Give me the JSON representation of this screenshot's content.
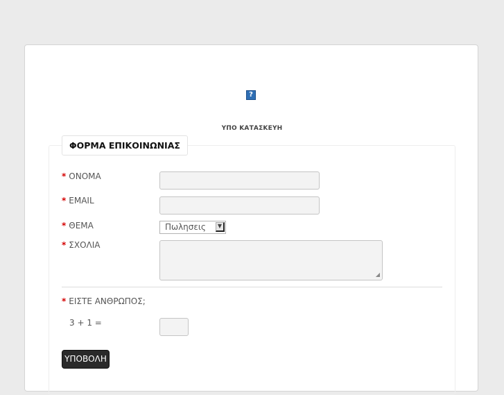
{
  "header": {
    "icon": "broken-image-question-icon",
    "icon_glyph": "?",
    "notice": "ΥΠΟ ΚΑΤΑΣΚΕΥΗ"
  },
  "form": {
    "legend": "ΦΟΡΜΑ ΕΠΙΚΟΙΝΩΝΙΑΣ",
    "required_mark": "*",
    "fields": {
      "name_label": "ΟΝΟΜΑ",
      "name_value": "",
      "email_label": "EMAIL",
      "email_value": "",
      "subject_label": "ΘΕΜΑ",
      "subject_selected": "Πωλησεις",
      "subject_arrow": "▼",
      "comments_label": "ΣΧΟΛΙΑ",
      "comments_value": ""
    },
    "captcha": {
      "label": "ΕΙΣΤΕ ΑΝΘΡΩΠΟΣ;",
      "question": "3 + 1 =",
      "answer": ""
    },
    "submit_label": "ΥΠΟΒΟΛΗ"
  },
  "colors": {
    "required": "#d40000",
    "submit_bg": "#2a2a2a",
    "page_bg": "#ebebeb"
  }
}
